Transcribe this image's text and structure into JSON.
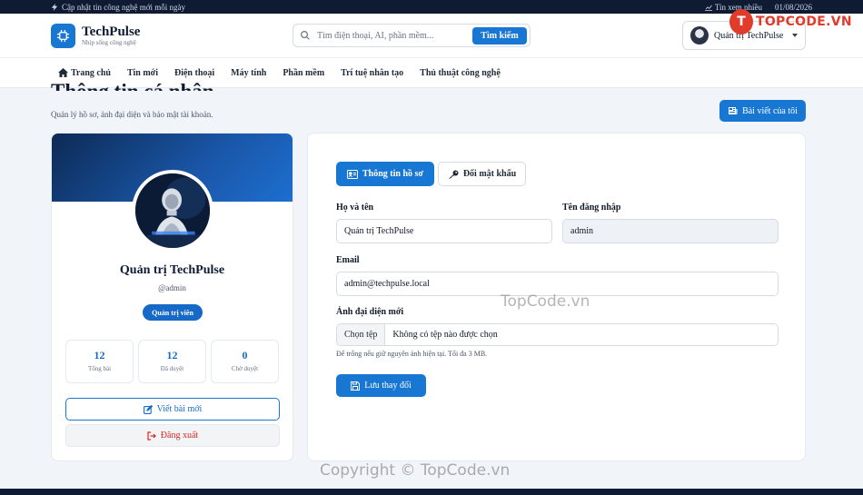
{
  "topbar": {
    "tagline": "Cập nhật tin công nghệ mới mỗi ngày",
    "trending": "Tin xem nhiều",
    "date": "01/08/2026"
  },
  "header": {
    "brand_name": "TechPulse",
    "brand_tagline": "Nhịp sống công nghệ",
    "search_placeholder": "Tìm điện thoại, AI, phần mềm...",
    "search_button": "Tìm kiếm",
    "user_name": "Quản trị TechPulse"
  },
  "nav": {
    "items": [
      "Trang chủ",
      "Tin mới",
      "Điện thoại",
      "Máy tính",
      "Phần mềm",
      "Trí tuệ nhân tạo",
      "Thủ thuật công nghệ"
    ]
  },
  "page": {
    "title": "Thông tin cá nhân",
    "subtitle": "Quản lý hồ sơ, ảnh đại diện và bảo mật tài khoản.",
    "my_posts_button": "Bài viết của tôi"
  },
  "profile": {
    "name": "Quản trị TechPulse",
    "username": "@admin",
    "role": "Quản trị viên",
    "stats": [
      {
        "value": "12",
        "label": "Tổng bài"
      },
      {
        "value": "12",
        "label": "Đã duyệt"
      },
      {
        "value": "0",
        "label": "Chờ duyệt"
      }
    ],
    "write_button": "Viết bài mới",
    "logout_button": "Đăng xuất"
  },
  "form": {
    "tab_profile": "Thông tin hồ sơ",
    "tab_password": "Đổi mật khẩu",
    "fullname_label": "Họ và tên",
    "fullname_value": "Quản trị TechPulse",
    "username_label": "Tên đăng nhập",
    "username_value": "admin",
    "email_label": "Email",
    "email_value": "admin@techpulse.local",
    "avatar_label": "Ảnh đại diện mới",
    "file_button": "Chọn tệp",
    "file_status": "Không có tệp nào được chọn",
    "hint": "Để trống nếu giữ nguyên ảnh hiện tại. Tối đa 3 MB.",
    "save_button": "Lưu thay đổi"
  },
  "watermark": {
    "logo_text": "TOPCODE.VN",
    "logo_letter": "T",
    "center": "TopCode.vn",
    "bottom": "Copyright © TopCode.vn"
  },
  "colors": {
    "primary": "#1877d2",
    "dark_navy": "#0e1b33",
    "danger": "#dc2626",
    "watermark_red": "#e03b2b"
  }
}
